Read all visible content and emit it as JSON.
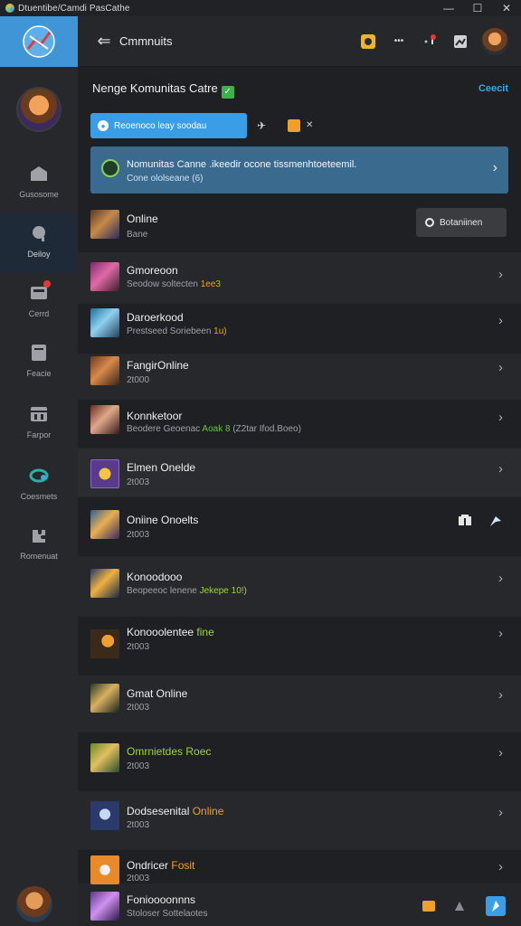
{
  "window": {
    "title": "Dtuentibe/Camdi PasCathe",
    "controls": [
      "—",
      "☐",
      "✕"
    ]
  },
  "sidebar": {
    "items": [
      {
        "label": "Gusosome",
        "icon": "home-icon"
      },
      {
        "label": "Deiloy",
        "icon": "search-icon"
      },
      {
        "label": "Cerrd",
        "icon": "inbox-icon"
      },
      {
        "label": "Feacie",
        "icon": "file-icon"
      },
      {
        "label": "Farpor",
        "icon": "calendar-icon"
      },
      {
        "label": "Coesmets",
        "icon": "link-icon"
      },
      {
        "label": "Romenuat",
        "icon": "puzzle-icon"
      }
    ]
  },
  "topbar": {
    "back": "⇐",
    "title": "Cmmnuits",
    "more": "•••"
  },
  "header": {
    "title": "Nenge Komunitas Catre",
    "link": "Ceecit"
  },
  "chip": {
    "label": "Reoenoco leay soodau"
  },
  "banner": {
    "line1": "Nomunitas Canne .ikeedir ocone tissmenhtoeteemil.",
    "line2": "Cone ololseane (6)"
  },
  "search_button": {
    "label": "Botaniinen"
  },
  "rows": [
    {
      "name": "Online",
      "sub": "Bane",
      "sub_class": "hl-blue"
    },
    {
      "name": "Gmoreoon",
      "sub_pre": "Seodow soltecten ",
      "sub_hl": "1ee3",
      "sub_class": "hl-orange"
    },
    {
      "name": "Daroerkood",
      "sub_pre": "Prestseed Soriebeen ",
      "sub_hl": "1u)",
      "sub_class": "hl-orange"
    },
    {
      "name": "FangirOnline",
      "sub": "2t000"
    },
    {
      "name": "Konnketoor",
      "sub_pre": "Beodere Geoenac ",
      "sub_hl": "Aoak 8",
      "sub_post": " (Z2tar Ifod.Boeo)",
      "sub_class": "hl-green"
    },
    {
      "name": "Elmen Onelde",
      "sub": "2t003"
    },
    {
      "name": "Oniine Onoelts",
      "sub": "2t003"
    },
    {
      "name": "Konoodooo",
      "sub_pre": "Beopeeoc lenene ",
      "sub_hl": "Jekepe 10!)",
      "sub_class": "hl-lime"
    },
    {
      "name": "Konooolentee",
      "name_hl": "fine",
      "sub": "2t003"
    },
    {
      "name": "Gmat Online",
      "sub": "2t003"
    },
    {
      "name": "Omrnietdes",
      "name_hl": "Roec",
      "sub": "2t003"
    },
    {
      "name": "Dodsesenital",
      "name_hl": "Online",
      "sub": "2t003"
    },
    {
      "name": "Ondricer",
      "name_hl": "Fosit",
      "sub": "2t003"
    },
    {
      "name": "Fonioooonnns",
      "sub": "Stoloser Sottelaotes"
    }
  ],
  "colors": {
    "accent": "#3a9ee6",
    "banner": "#3a6b8f",
    "orange": "#f0a02a",
    "green": "#6cc04a"
  }
}
